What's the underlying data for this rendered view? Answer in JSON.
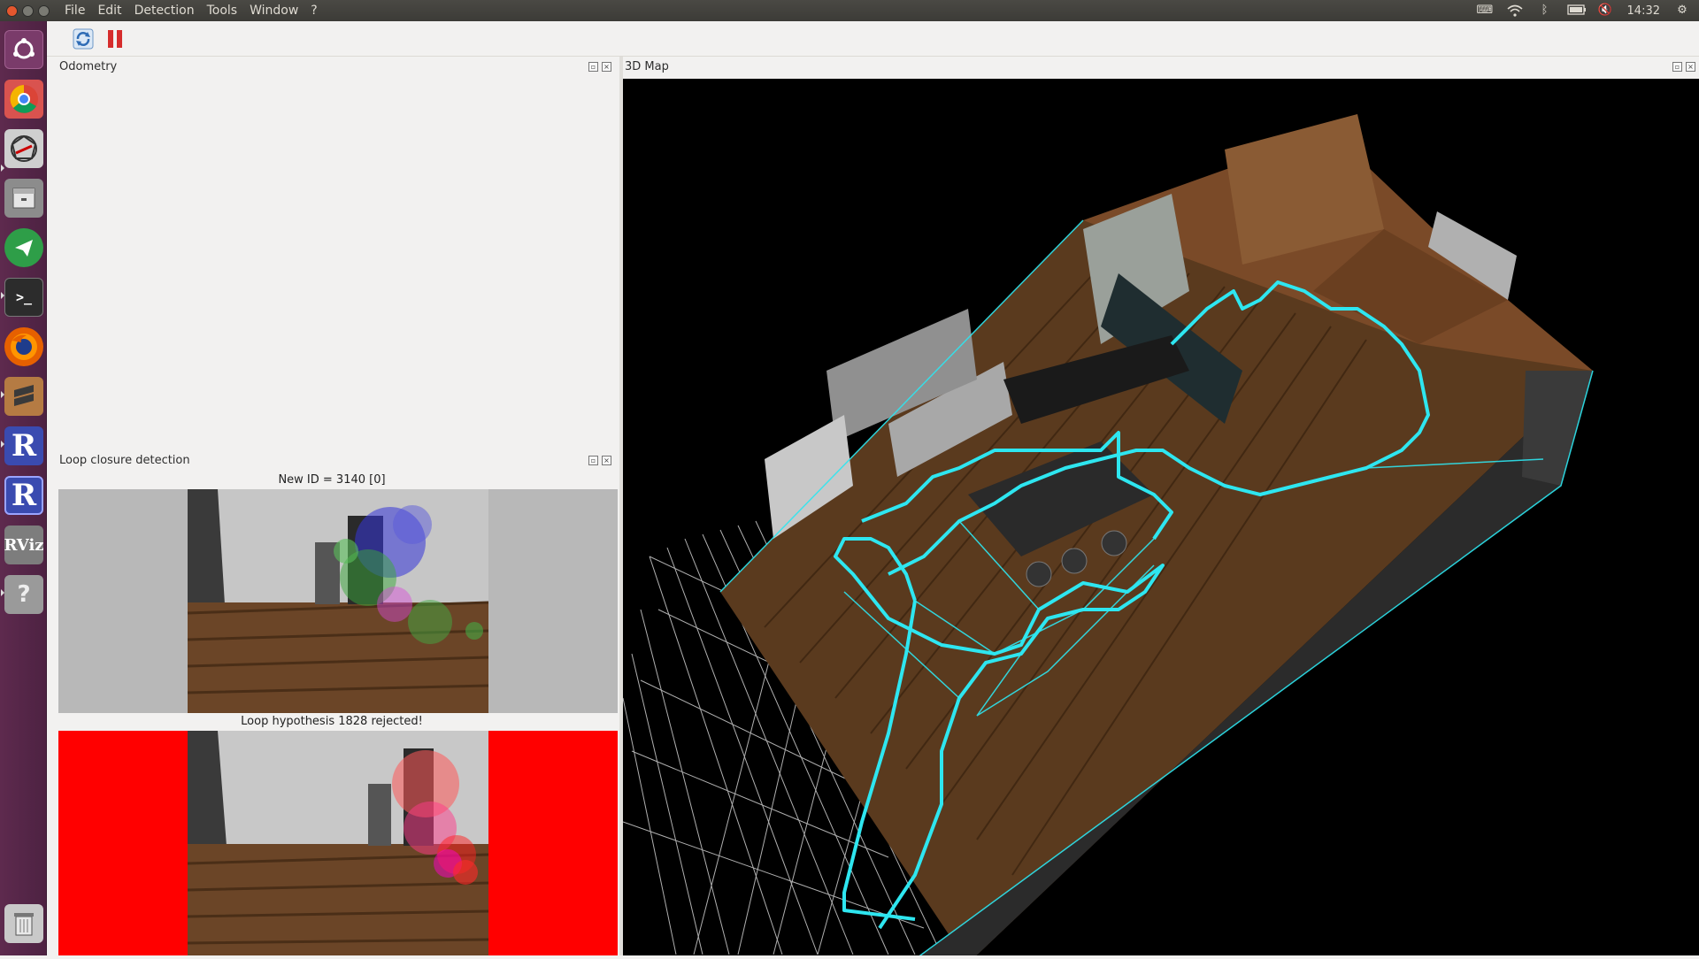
{
  "menubar": {
    "items": [
      "File",
      "Edit",
      "Detection",
      "Tools",
      "Window",
      "?"
    ],
    "clock": "14:32"
  },
  "tray_icons": [
    "keyboard-icon",
    "wifi-icon",
    "bluetooth-icon",
    "battery-icon",
    "volume-mute-icon",
    "settings-gear-icon"
  ],
  "launcher": [
    {
      "name": "ubuntu-dash-icon",
      "color": "#7a3b6a"
    },
    {
      "name": "chrome-icon",
      "color": "#4285f4"
    },
    {
      "name": "network-app-icon",
      "color": "#5a5a5a"
    },
    {
      "name": "files-icon",
      "color": "#8c8c8c"
    },
    {
      "name": "telegram-icon",
      "color": "#2e9e48"
    },
    {
      "name": "terminal-icon",
      "color": "#2c2c2c"
    },
    {
      "name": "firefox-icon",
      "color": "#e66000"
    },
    {
      "name": "sublime-icon",
      "color": "#c48a4b"
    },
    {
      "name": "rtabmap-icon",
      "color": "#3a4bb0"
    },
    {
      "name": "rtabmap-icon-2",
      "color": "#3a4bb0"
    },
    {
      "name": "rviz-icon",
      "color": "#7d7d7d"
    },
    {
      "name": "unknown-app-icon",
      "color": "#9a9a9a"
    },
    {
      "name": "trash-icon",
      "color": "#c9c9c9"
    }
  ],
  "panels": {
    "odometry": {
      "title": "Odometry"
    },
    "loop": {
      "title": "Loop closure detection",
      "new_id": "New ID = 3140 [0]",
      "hypothesis": "Loop hypothesis 1828 rejected!"
    },
    "map": {
      "title": "3D Map"
    }
  },
  "colors": {
    "trajectory": "#2ee6f0",
    "rejected": "#ff0000",
    "floor": "#5a3a1e"
  }
}
